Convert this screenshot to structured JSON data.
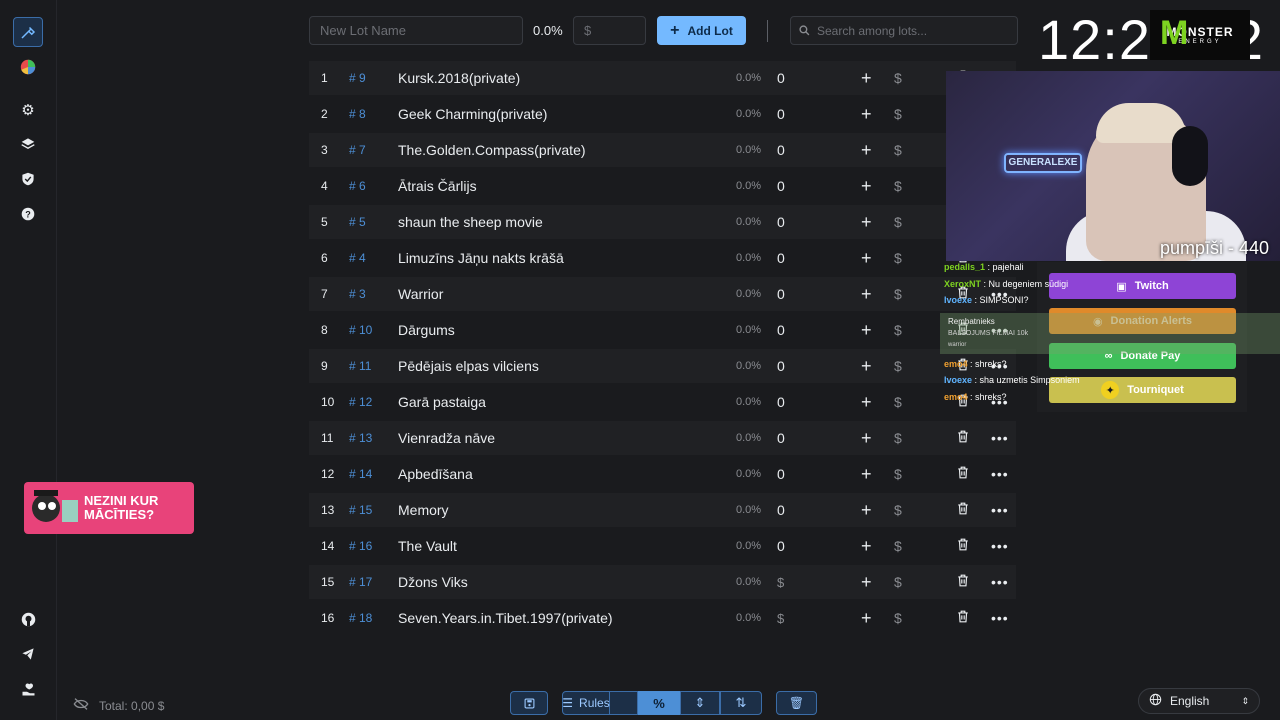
{
  "sidebar": {
    "top_icons": [
      "hammer-icon",
      "pie-chart-icon",
      "gear-icon",
      "layers-icon",
      "shield-check-icon",
      "help-icon"
    ],
    "bottom_icons": [
      "github-icon",
      "telegram-icon",
      "donate-icon"
    ]
  },
  "toolbar": {
    "lot_name_placeholder": "New Lot Name",
    "percent": "0.0%",
    "amount_placeholder": "$",
    "add_lot_label": "Add Lot",
    "search_placeholder": "Search among lots..."
  },
  "lots": [
    {
      "idx": "1",
      "id": "# 9",
      "name": "Kursk.2018(private)",
      "pct": "0.0%",
      "amount": "0"
    },
    {
      "idx": "2",
      "id": "# 8",
      "name": "Geek Charming(private)",
      "pct": "0.0%",
      "amount": "0"
    },
    {
      "idx": "3",
      "id": "# 7",
      "name": "The.Golden.Compass(private)",
      "pct": "0.0%",
      "amount": "0"
    },
    {
      "idx": "4",
      "id": "# 6",
      "name": "Ātrais Čārlijs",
      "pct": "0.0%",
      "amount": "0"
    },
    {
      "idx": "5",
      "id": "# 5",
      "name": "shaun the sheep movie",
      "pct": "0.0%",
      "amount": "0"
    },
    {
      "idx": "6",
      "id": "# 4",
      "name": "Limuzīns Jāņu nakts krāšā",
      "pct": "0.0%",
      "amount": "0"
    },
    {
      "idx": "7",
      "id": "# 3",
      "name": "Warrior",
      "pct": "0.0%",
      "amount": "0"
    },
    {
      "idx": "8",
      "id": "# 10",
      "name": "Dārgums",
      "pct": "0.0%",
      "amount": "0"
    },
    {
      "idx": "9",
      "id": "# 11",
      "name": "Pēdējais elpas vilciens",
      "pct": "0.0%",
      "amount": "0"
    },
    {
      "idx": "10",
      "id": "# 12",
      "name": "Garā pastaiga",
      "pct": "0.0%",
      "amount": "0"
    },
    {
      "idx": "11",
      "id": "# 13",
      "name": "Vienradža nāve",
      "pct": "0.0%",
      "amount": "0"
    },
    {
      "idx": "12",
      "id": "# 14",
      "name": "Apbedīšana",
      "pct": "0.0%",
      "amount": "0"
    },
    {
      "idx": "13",
      "id": "# 15",
      "name": "Memory",
      "pct": "0.0%",
      "amount": "0"
    },
    {
      "idx": "14",
      "id": "# 16",
      "name": "The Vault",
      "pct": "0.0%",
      "amount": "0"
    },
    {
      "idx": "15",
      "id": "# 17",
      "name": "Džons Viks",
      "pct": "0.0%",
      "amount": "$"
    },
    {
      "idx": "16",
      "id": "# 18",
      "name": "Seven.Years.in.Tibet.1997(private)",
      "pct": "0.0%",
      "amount": "$"
    }
  ],
  "row_actions": {
    "plus": "+",
    "dollar": "$",
    "trash": "🗑",
    "more": "•••"
  },
  "bottom": {
    "total": "Total: 0,00 $",
    "rules_label": "Rules",
    "percent_label": "%",
    "language": "English"
  },
  "overlay": {
    "clock": "12:28:02",
    "brand_word": "MONSTER",
    "brand_sub": "ENERGY",
    "neon_sign": "GENERALEXE",
    "cam_label": "pumpīši - 440",
    "chat": [
      {
        "user": "pedalls_1",
        "msg": "pajehali",
        "color": "#7ed321"
      },
      {
        "user": "XeroxNT",
        "msg": "Nu degeniem sūdigi",
        "color": "#7ed321"
      },
      {
        "user": "Ivoexe",
        "msg": "SIMPSONI?",
        "color": "#5fb4ff"
      },
      {
        "user": "emo4",
        "msg": "shreks?",
        "color": "#f0a030"
      },
      {
        "user": "Ivoexe",
        "msg": "sha uzmetis Simpsoniem",
        "color": "#5fb4ff"
      },
      {
        "user": "emo4",
        "msg": "shreks?",
        "color": "#f0a030"
      }
    ],
    "alert": {
      "user": "Rembatnieks",
      "msg": "BALSOJUMS FILMAI 10k",
      "sub": "warrior"
    },
    "donate_buttons": [
      "Twitch",
      "Donation Alerts",
      "Donate Pay",
      "Tourniquet"
    ],
    "promo_text": "NEZINI KUR MĀCĪTIES?"
  },
  "colors": {
    "accent": "#74b9ff",
    "link": "#4d8fd6",
    "bg": "#1a1b1e"
  }
}
